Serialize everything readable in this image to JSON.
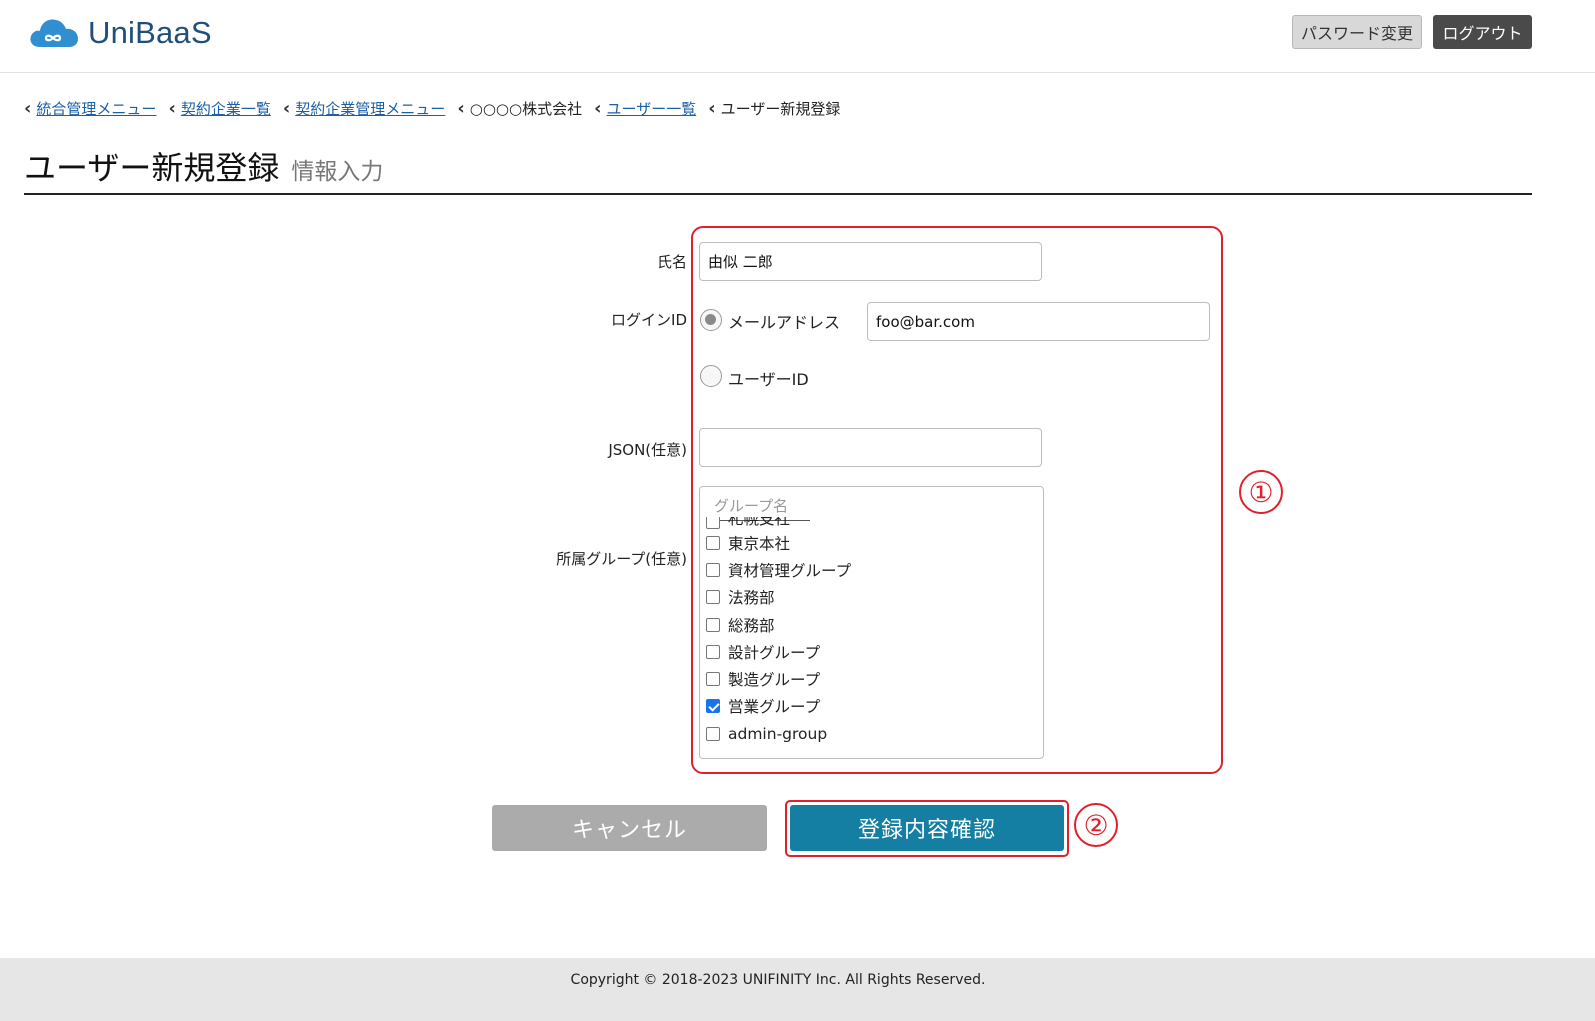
{
  "app": {
    "name": "UniBaaS"
  },
  "header": {
    "password_change": "パスワード変更",
    "logout": "ログアウト"
  },
  "breadcrumb": [
    {
      "label": "統合管理メニュー",
      "link": true
    },
    {
      "label": "契約企業一覧",
      "link": true
    },
    {
      "label": "契約企業管理メニュー",
      "link": true
    },
    {
      "label": "○○○○株式会社",
      "link": false
    },
    {
      "label": "ユーザー一覧",
      "link": true
    },
    {
      "label": "ユーザー新規登録",
      "link": false
    }
  ],
  "page": {
    "title": "ユーザー新規登録",
    "subtitle": "情報入力"
  },
  "form": {
    "name_label": "氏名",
    "name_value": "由似 二郎",
    "login_label": "ログインID",
    "login_option_email": "メールアドレス",
    "login_option_userid": "ユーザーID",
    "login_selected": "email",
    "email_value": "foo@bar.com",
    "json_label": "JSON(任意)",
    "json_value": "",
    "group_label": "所属グループ(任意)",
    "group_search_placeholder": "グループ名",
    "groups": [
      {
        "label": "札幌支社",
        "checked": false
      },
      {
        "label": "東京本社",
        "checked": false
      },
      {
        "label": "資材管理グループ",
        "checked": false
      },
      {
        "label": "法務部",
        "checked": false
      },
      {
        "label": "総務部",
        "checked": false
      },
      {
        "label": "設計グループ",
        "checked": false
      },
      {
        "label": "製造グループ",
        "checked": false
      },
      {
        "label": "営業グループ",
        "checked": true
      },
      {
        "label": "admin-group",
        "checked": false
      }
    ]
  },
  "buttons": {
    "cancel": "キャンセル",
    "confirm": "登録内容確認"
  },
  "annotations": {
    "one": "①",
    "two": "②",
    "color": "#e0202a"
  },
  "footer": {
    "copyright": "Copyright © 2018-2023 UNIFINITY Inc. All Rights Reserved."
  }
}
